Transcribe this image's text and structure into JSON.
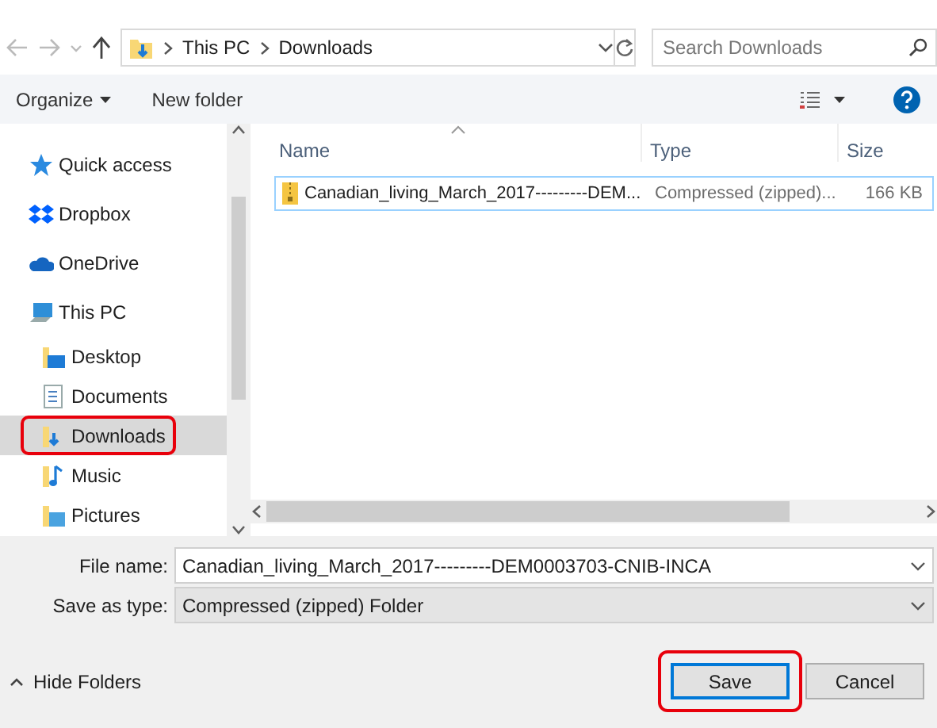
{
  "address_bar": {
    "path": [
      "This PC",
      "Downloads"
    ]
  },
  "search": {
    "placeholder": "Search Downloads"
  },
  "toolbar": {
    "items": [
      {
        "label": "Organize",
        "kind": "menu"
      },
      {
        "label": "New folder",
        "kind": "button"
      }
    ]
  },
  "sidebar": {
    "items": [
      {
        "label": "Quick access",
        "selected": false,
        "annotated": false
      },
      {
        "label": "Dropbox",
        "selected": false,
        "annotated": false
      },
      {
        "label": "OneDrive",
        "selected": false,
        "annotated": false
      },
      {
        "label": "This PC",
        "selected": false,
        "annotated": false,
        "children": [
          {
            "label": "Desktop",
            "selected": false,
            "annotated": false
          },
          {
            "label": "Documents",
            "selected": false,
            "annotated": false
          },
          {
            "label": "Downloads",
            "selected": true,
            "annotated": true
          },
          {
            "label": "Music",
            "selected": false,
            "annotated": false
          },
          {
            "label": "Pictures",
            "selected": false,
            "annotated": false
          }
        ]
      }
    ]
  },
  "file_list": {
    "columns": [
      {
        "label": "Name",
        "sorted": true
      },
      {
        "label": "Type",
        "sorted": false
      },
      {
        "label": "Size",
        "sorted": false
      }
    ],
    "rows": [
      {
        "name": "Canadian_living_March_2017---------DEM...",
        "type": "Compressed (zipped)...",
        "size": "166 KB",
        "focused": true
      }
    ]
  },
  "form": {
    "fields": [
      {
        "label": "File name:",
        "value": "Canadian_living_March_2017---------DEM0003703-CNIB-INCA",
        "kind": "combo"
      },
      {
        "label": "Save as type:",
        "value": "Compressed (zipped) Folder",
        "kind": "select"
      }
    ]
  },
  "hide_folders": "Hide Folders",
  "buttons": [
    {
      "label": "Save",
      "default": true,
      "annotated": true
    },
    {
      "label": "Cancel",
      "default": false,
      "annotated": false
    }
  ]
}
